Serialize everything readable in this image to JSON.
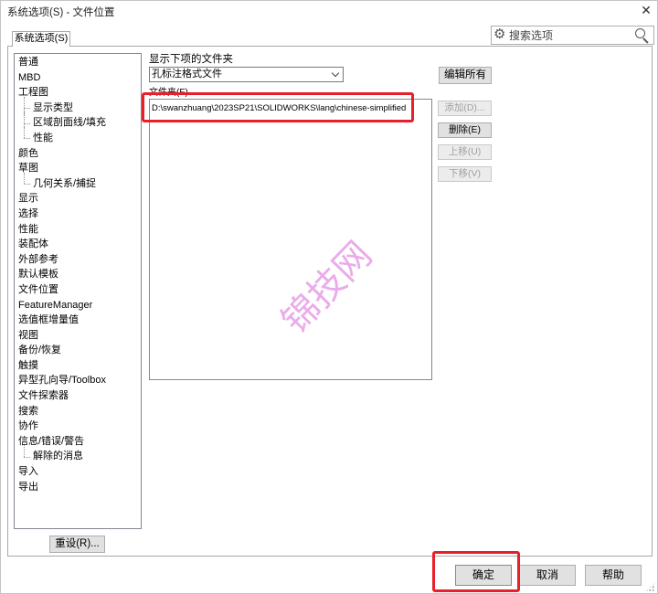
{
  "window": {
    "title": "系统选项(S) - 文件位置"
  },
  "tabs": [
    {
      "label": "系统选项(S)"
    }
  ],
  "search": {
    "placeholder": "搜索选项"
  },
  "icons": {
    "close": "close-icon",
    "gear": "gear-icon",
    "search": "search-icon",
    "dropdown": "chevron-down-icon"
  },
  "sidebar": {
    "items": [
      {
        "label": "普通"
      },
      {
        "label": "MBD"
      },
      {
        "label": "工程图",
        "children": [
          {
            "label": "显示类型"
          },
          {
            "label": "区域剖面线/填充"
          },
          {
            "label": "性能"
          }
        ]
      },
      {
        "label": "颜色"
      },
      {
        "label": "草图",
        "children": [
          {
            "label": "几何关系/捕捉"
          }
        ]
      },
      {
        "label": "显示"
      },
      {
        "label": "选择"
      },
      {
        "label": "性能"
      },
      {
        "label": "装配体"
      },
      {
        "label": "外部参考"
      },
      {
        "label": "默认模板"
      },
      {
        "label": "文件位置"
      },
      {
        "label": "FeatureManager"
      },
      {
        "label": "选值框增量值"
      },
      {
        "label": "视图"
      },
      {
        "label": "备份/恢复"
      },
      {
        "label": "触摸"
      },
      {
        "label": "异型孔向导/Toolbox"
      },
      {
        "label": "文件探索器"
      },
      {
        "label": "搜索"
      },
      {
        "label": "协作"
      },
      {
        "label": "信息/错误/警告",
        "children": [
          {
            "label": "解除的消息"
          }
        ]
      },
      {
        "label": "导入"
      },
      {
        "label": "导出"
      }
    ],
    "reset_label": "重设(R)..."
  },
  "folders": {
    "show_label": "显示下项的文件夹",
    "selected_type": "孔标注格式文件",
    "edit_all_label": "编辑所有",
    "list_label": "文件夹(F)",
    "entries": [
      "D:\\swanzhuang\\2023SP21\\SOLIDWORKS\\lang\\chinese-simplified"
    ],
    "buttons": [
      {
        "label": "添加(D)...",
        "enabled": false
      },
      {
        "label": "删除(E)",
        "enabled": true
      },
      {
        "label": "上移(U)",
        "enabled": false
      },
      {
        "label": "下移(V)",
        "enabled": false
      }
    ]
  },
  "footer": {
    "ok_label": "确定",
    "cancel_label": "取消",
    "help_label": "帮助"
  },
  "watermark": {
    "text": "锦技网"
  },
  "colors": {
    "annotation": "#e8202a",
    "watermark": "#eaacea"
  }
}
